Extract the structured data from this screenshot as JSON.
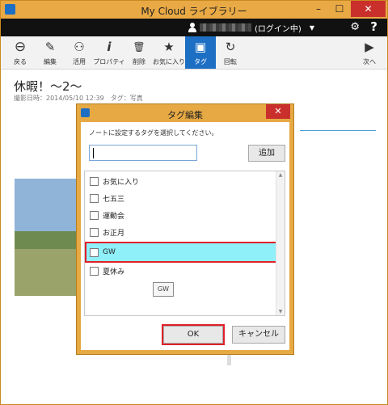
{
  "window": {
    "title": "My Cloud ライブラリー",
    "minimize": "–",
    "maximize": "☐",
    "close": "✕"
  },
  "account": {
    "status": "(ログイン中)",
    "menu_arrow": "▼"
  },
  "icons": {
    "settings": "⚙",
    "help": "?"
  },
  "toolbar": {
    "items": [
      {
        "label": "戻る",
        "icon": "back-icon",
        "glyph": "⊖"
      },
      {
        "label": "編集",
        "icon": "pencil-icon",
        "glyph": "✎"
      },
      {
        "label": "活用",
        "icon": "share-icon",
        "glyph": "⚇"
      },
      {
        "label": "プロパティ",
        "icon": "info-icon",
        "glyph": "i"
      },
      {
        "label": "削除",
        "icon": "trash-icon",
        "glyph": "🗑"
      },
      {
        "label": "お気に入り",
        "icon": "star-icon",
        "glyph": "★"
      },
      {
        "label": "タグ",
        "icon": "tag-icon",
        "glyph": "▣",
        "active": true
      },
      {
        "label": "回転",
        "icon": "rotate-icon",
        "glyph": "↻"
      }
    ],
    "next": {
      "label": "次へ",
      "glyph": "▶"
    }
  },
  "note": {
    "title": "休暇！～2～",
    "meta": "撮影日時：2014/05/10 12:39　タグ：写真"
  },
  "dialog": {
    "title": "タグ編集",
    "close": "✕",
    "instruction": "ノートに設定するタグを選択してください。",
    "input_value": "",
    "add_button": "追加",
    "tags": [
      {
        "label": "お気に入り",
        "checked": false
      },
      {
        "label": "七五三",
        "checked": false
      },
      {
        "label": "運動会",
        "checked": false
      },
      {
        "label": "お正月",
        "checked": false
      },
      {
        "label": "GW",
        "checked": false,
        "selected": true
      },
      {
        "label": "夏休み",
        "checked": false
      }
    ],
    "drag_ghost": "GW",
    "ok_button": "OK",
    "cancel_button": "キャンセル"
  },
  "colors": {
    "accent": "#1d6fc4",
    "frame": "#e7a944",
    "highlight": "#8ff0fa",
    "callout": "#e0202a"
  }
}
